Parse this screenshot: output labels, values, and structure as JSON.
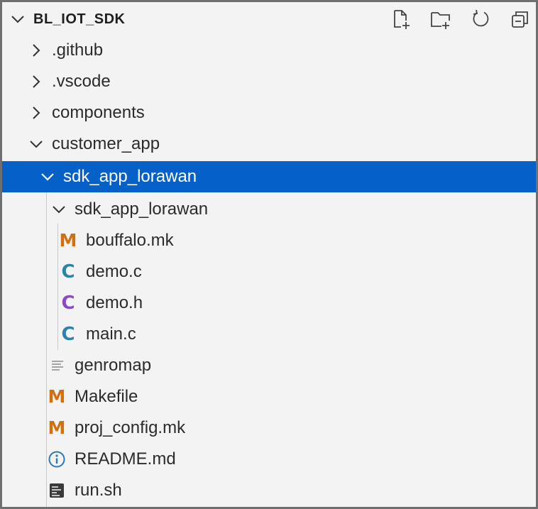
{
  "explorer": {
    "root_title": "BL_IOT_SDK",
    "toolbar": {
      "new_file_icon": "new-file-icon",
      "new_folder_icon": "new-folder-icon",
      "refresh_icon": "refresh-icon",
      "collapse_all_icon": "collapse-all-icon"
    },
    "tree": [
      {
        "label": ".github",
        "kind": "folder",
        "expanded": false
      },
      {
        "label": ".vscode",
        "kind": "folder",
        "expanded": false
      },
      {
        "label": "components",
        "kind": "folder",
        "expanded": false
      },
      {
        "label": "customer_app",
        "kind": "folder",
        "expanded": true
      },
      {
        "label": "sdk_app_lorawan",
        "kind": "folder",
        "expanded": true,
        "selected": true
      },
      {
        "label": "sdk_app_lorawan",
        "kind": "folder",
        "expanded": true
      },
      {
        "label": "bouffalo.mk",
        "kind": "makefile",
        "icon": "M"
      },
      {
        "label": "demo.c",
        "kind": "c-source",
        "icon": "C"
      },
      {
        "label": "demo.h",
        "kind": "c-header",
        "icon": "C"
      },
      {
        "label": "main.c",
        "kind": "c-source",
        "icon": "C"
      },
      {
        "label": "genromap",
        "kind": "plain-text"
      },
      {
        "label": "Makefile",
        "kind": "makefile",
        "icon": "M"
      },
      {
        "label": "proj_config.mk",
        "kind": "makefile",
        "icon": "M"
      },
      {
        "label": "README.md",
        "kind": "readme"
      },
      {
        "label": "run.sh",
        "kind": "shell-script"
      }
    ]
  },
  "colors": {
    "selection": "#0560c8",
    "makefile_icon": "#d0700e",
    "c_source_icon": "#2b84a8",
    "c_header_icon": "#8a4bc2",
    "readme_icon": "#2b7ab8"
  }
}
